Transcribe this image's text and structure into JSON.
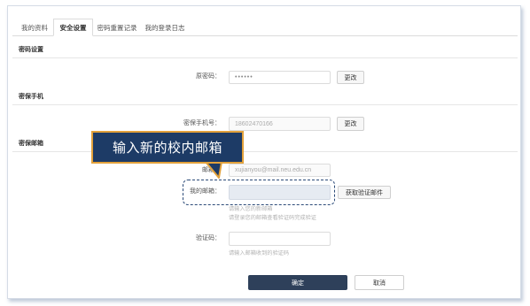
{
  "tabs": [
    {
      "label": "我的资料"
    },
    {
      "label": "安全设置",
      "active": true
    },
    {
      "label": "密码重置记录"
    },
    {
      "label": "我的登录日志"
    }
  ],
  "password": {
    "title": "密码设置",
    "label": "原密码：",
    "value": "••••••",
    "button": "更改"
  },
  "phone": {
    "title": "密保手机",
    "label": "密保手机号：",
    "value": "18602470166",
    "button": "更改"
  },
  "email": {
    "title": "密保邮箱",
    "current_label": "邮箱：",
    "current_value": "xujianyou@mail.neu.edu.cn",
    "new_label": "我的邮箱：",
    "new_value": "",
    "send_button": "获取验证邮件",
    "hint1": "请输入您的新邮箱",
    "hint2": "请登录您的邮箱查看验证码完成验证",
    "code_label": "验证码：",
    "code_value": "",
    "code_hint": "请输入邮箱收到的验证码"
  },
  "actions": {
    "confirm": "确定",
    "cancel": "取消"
  },
  "callout": {
    "text": "输入新的校内邮箱"
  },
  "colors": {
    "primary_button": "#2e405a",
    "callout_fill": "#1d3b66",
    "callout_border": "#e2a13b",
    "highlight_dash": "#2b4a78"
  }
}
